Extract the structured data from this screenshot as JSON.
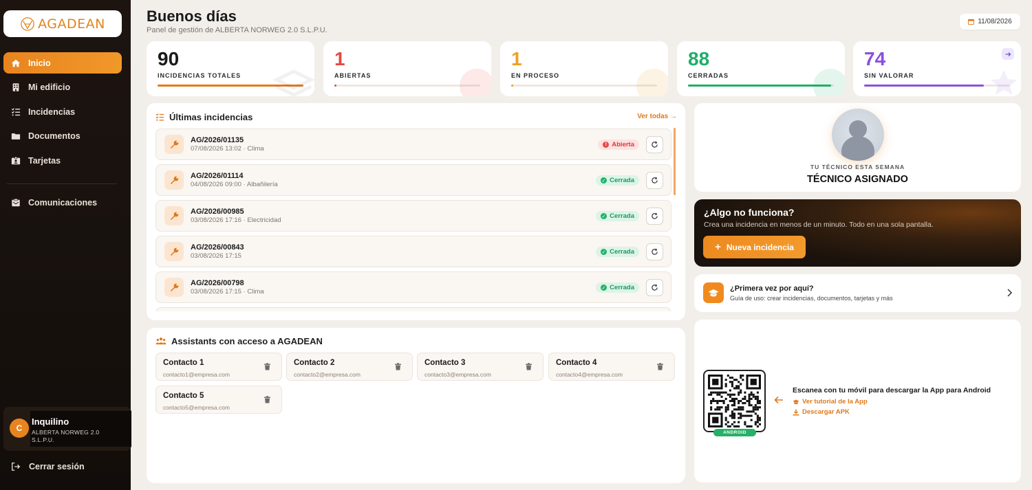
{
  "brand": {
    "logo_text": "AGADEAN",
    "accent": "#e8841f"
  },
  "sidebar": {
    "items": [
      {
        "label": "Inicio",
        "icon": "home-icon",
        "active": true
      },
      {
        "label": "Mi edificio",
        "icon": "building-icon"
      },
      {
        "label": "Incidencias",
        "icon": "list-icon"
      },
      {
        "label": "Documentos",
        "icon": "folder-icon"
      },
      {
        "label": "Tarjetas",
        "icon": "id-card-icon"
      }
    ],
    "secondary": [
      {
        "label": "Comunicaciones",
        "icon": "mail-icon"
      }
    ],
    "user": {
      "initial": "C",
      "role": "Inquilino",
      "org": "ALBERTA NORWEG 2.0 S.L.P.U."
    },
    "logout_label": "Cerrar sesión"
  },
  "header": {
    "greeting": "Buenos días",
    "subtitle": "Panel de gestión de ALBERTA NORWEG 2.0 S.L.P.U.",
    "date": "11/08/2026"
  },
  "stats": [
    {
      "value": "90",
      "label": "INCIDENCIAS TOTALES",
      "color": "#e8781a",
      "progress": 1.0
    },
    {
      "value": "1",
      "label": "ABIERTAS",
      "color": "#e34a44",
      "progress": 0.01
    },
    {
      "value": "1",
      "label": "EN PROCESO",
      "color": "#f0a020",
      "progress": 0.01
    },
    {
      "value": "88",
      "label": "CERRADAS",
      "color": "#1fae6a",
      "progress": 0.98
    },
    {
      "value": "74",
      "label": "SIN VALORAR",
      "color": "#8a4fe0",
      "progress": 0.82
    }
  ],
  "incidents": {
    "title": "Últimas incidencias",
    "see_all": "Ver todas",
    "items": [
      {
        "code": "AG/2026/01135",
        "meta": "07/08/2026 13:02 · Clima",
        "status": "Abierta",
        "status_kind": "open"
      },
      {
        "code": "AG/2026/01114",
        "meta": "04/08/2026 09:00 · Albañilería",
        "status": "Cerrada",
        "status_kind": "closed"
      },
      {
        "code": "AG/2026/00985",
        "meta": "03/08/2026 17:16 · Electricidad",
        "status": "Cerrada",
        "status_kind": "closed"
      },
      {
        "code": "AG/2026/00843",
        "meta": "03/08/2026 17:15",
        "status": "Cerrada",
        "status_kind": "closed"
      },
      {
        "code": "AG/2026/00798",
        "meta": "03/08/2026 17:15 · Clima",
        "status": "Cerrada",
        "status_kind": "closed"
      }
    ]
  },
  "assistants": {
    "title": "Assistants con acceso a AGADEAN",
    "contacts": [
      {
        "name": "Contacto 1",
        "email": "contacto1@empresa.com"
      },
      {
        "name": "Contacto 2",
        "email": "contacto2@empresa.com"
      },
      {
        "name": "Contacto 3",
        "email": "contacto3@empresa.com"
      },
      {
        "name": "Contacto 4",
        "email": "contacto4@empresa.com"
      },
      {
        "name": "Contacto 5",
        "email": "contacto5@empresa.com"
      }
    ]
  },
  "technician": {
    "label": "TU TÉCNICO ESTA SEMANA",
    "name": "TÉCNICO ASIGNADO"
  },
  "promo": {
    "title": "¿Algo no funciona?",
    "subtitle": "Crea una incidencia en menos de un minuto. Todo en una sola pantalla.",
    "button": "Nueva incidencia"
  },
  "guide": {
    "title": "¿Primera vez por aquí?",
    "subtitle": "Guía de uso: crear incidencias, documentos, tarjetas y más"
  },
  "app": {
    "title": "Escanea con tu móvil para descargar la App para Android",
    "tutorial_link": "Ver tutorial de la App",
    "apk_link": "Descargar APK",
    "qr_tag": "ANDROID"
  }
}
